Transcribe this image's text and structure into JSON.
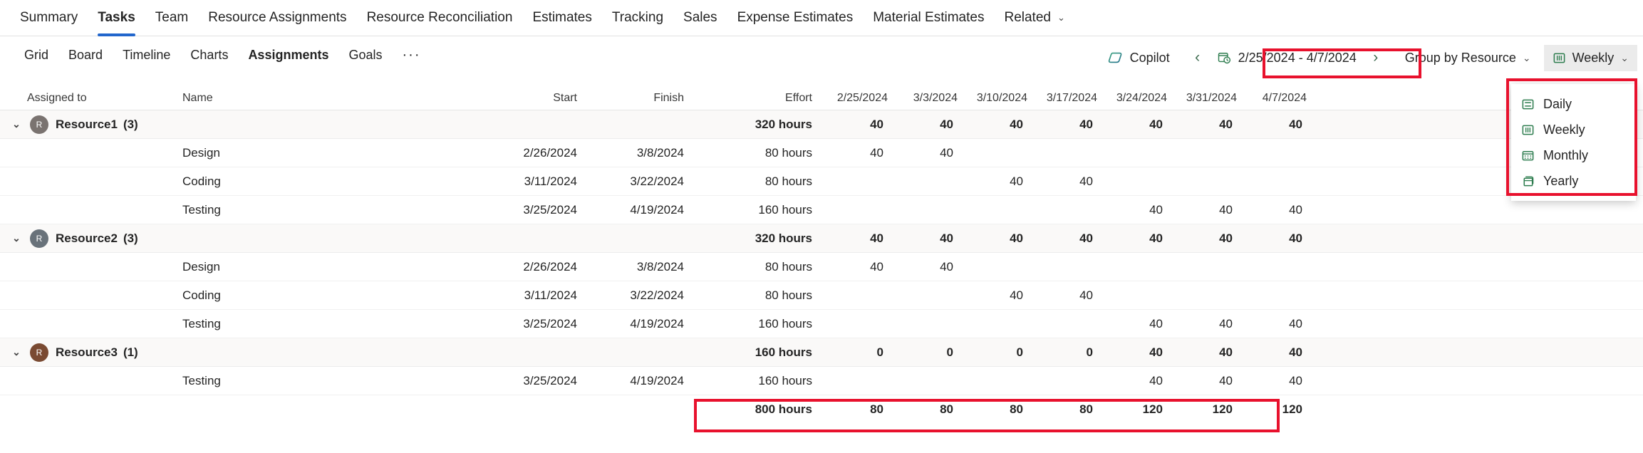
{
  "entity_nav": {
    "tabs": [
      {
        "label": "Summary",
        "active": false
      },
      {
        "label": "Tasks",
        "active": true
      },
      {
        "label": "Team",
        "active": false
      },
      {
        "label": "Resource Assignments",
        "active": false
      },
      {
        "label": "Resource Reconciliation",
        "active": false
      },
      {
        "label": "Estimates",
        "active": false
      },
      {
        "label": "Tracking",
        "active": false
      },
      {
        "label": "Sales",
        "active": false
      },
      {
        "label": "Expense Estimates",
        "active": false
      },
      {
        "label": "Material Estimates",
        "active": false
      },
      {
        "label": "Related",
        "active": false,
        "caret": "⌄"
      }
    ]
  },
  "command_bar": {
    "view_tabs": [
      {
        "label": "Grid",
        "active": false
      },
      {
        "label": "Board",
        "active": false
      },
      {
        "label": "Timeline",
        "active": false
      },
      {
        "label": "Charts",
        "active": false
      },
      {
        "label": "Assignments",
        "active": true
      },
      {
        "label": "Goals",
        "active": false
      }
    ],
    "overflow_label": "···",
    "copilot_label": "Copilot",
    "prev_arrow": "‹",
    "next_arrow": "›",
    "date_range": "2/25/2024 - 4/7/2024",
    "group_by_label": "Group by Resource",
    "scale_label": "Weekly",
    "chevron": "⌄"
  },
  "scale_menu": {
    "items": [
      {
        "label": "Daily",
        "icon": "daily-scale-icon"
      },
      {
        "label": "Weekly",
        "icon": "weekly-scale-icon"
      },
      {
        "label": "Monthly",
        "icon": "monthly-scale-icon"
      },
      {
        "label": "Yearly",
        "icon": "yearly-scale-icon"
      }
    ]
  },
  "grid": {
    "columns": {
      "assigned_to": "Assigned to",
      "name": "Name",
      "start": "Start",
      "finish": "Finish",
      "effort": "Effort"
    },
    "date_columns": [
      "2/25/2024",
      "3/3/2024",
      "3/10/2024",
      "3/17/2024",
      "3/24/2024",
      "3/31/2024",
      "4/7/2024"
    ],
    "groups": [
      {
        "resource": "Resource1",
        "count": "(3)",
        "avatar_initial": "R",
        "avatar_color": "#7a7370",
        "expander": "⌄",
        "effort": "320 hours",
        "values": [
          "40",
          "40",
          "40",
          "40",
          "40",
          "40",
          "40"
        ],
        "tasks": [
          {
            "name": "Design",
            "start": "2/26/2024",
            "finish": "3/8/2024",
            "effort": "80 hours",
            "values": [
              "40",
              "40",
              "",
              "",
              "",
              "",
              ""
            ]
          },
          {
            "name": "Coding",
            "start": "3/11/2024",
            "finish": "3/22/2024",
            "effort": "80 hours",
            "values": [
              "",
              "",
              "40",
              "40",
              "",
              "",
              ""
            ]
          },
          {
            "name": "Testing",
            "start": "3/25/2024",
            "finish": "4/19/2024",
            "effort": "160 hours",
            "values": [
              "",
              "",
              "",
              "",
              "40",
              "40",
              "40"
            ]
          }
        ]
      },
      {
        "resource": "Resource2",
        "count": "(3)",
        "avatar_initial": "R",
        "avatar_color": "#69727a",
        "expander": "⌄",
        "effort": "320 hours",
        "values": [
          "40",
          "40",
          "40",
          "40",
          "40",
          "40",
          "40"
        ],
        "tasks": [
          {
            "name": "Design",
            "start": "2/26/2024",
            "finish": "3/8/2024",
            "effort": "80 hours",
            "values": [
              "40",
              "40",
              "",
              "",
              "",
              "",
              ""
            ]
          },
          {
            "name": "Coding",
            "start": "3/11/2024",
            "finish": "3/22/2024",
            "effort": "80 hours",
            "values": [
              "",
              "",
              "40",
              "40",
              "",
              "",
              ""
            ]
          },
          {
            "name": "Testing",
            "start": "3/25/2024",
            "finish": "4/19/2024",
            "effort": "160 hours",
            "values": [
              "",
              "",
              "",
              "",
              "40",
              "40",
              "40"
            ]
          }
        ]
      },
      {
        "resource": "Resource3",
        "count": "(1)",
        "avatar_initial": "R",
        "avatar_color": "#7a4a32",
        "expander": "⌄",
        "effort": "160 hours",
        "values": [
          "0",
          "0",
          "0",
          "0",
          "40",
          "40",
          "40"
        ],
        "tasks": [
          {
            "name": "Testing",
            "start": "3/25/2024",
            "finish": "4/19/2024",
            "effort": "160 hours",
            "values": [
              "",
              "",
              "",
              "",
              "40",
              "40",
              "40"
            ]
          }
        ]
      }
    ],
    "total_row": {
      "effort": "800 hours",
      "values": [
        "80",
        "80",
        "80",
        "80",
        "120",
        "120",
        "120"
      ]
    }
  },
  "colors": {
    "accent": "#2266cc",
    "annotation": "#e8112d",
    "icon_green": "#2e7d4f",
    "group_row_bg": "#faf9f8"
  }
}
